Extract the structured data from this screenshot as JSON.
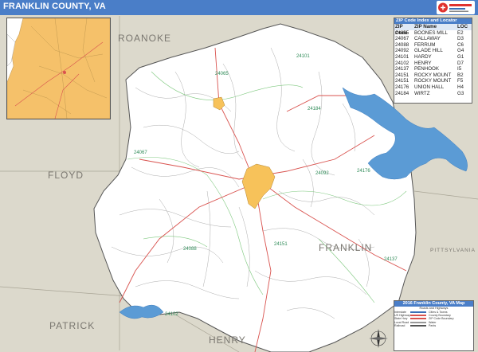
{
  "title": "FRANKLIN COUNTY, VA",
  "colors": {
    "title_bar": "#4a7ec8",
    "surrounding_land": "#dcd9cc",
    "county_fill": "#ffffff",
    "water": "#5b9bd5",
    "city_fill": "#f7c25a",
    "inset_state": "#f5c16a",
    "highways": "#d9534f",
    "minor_roads": "#9a9a9a",
    "route_labels": "#2e8b57"
  },
  "neighbor_counties": {
    "roanoke": "ROANOKE",
    "floyd": "FLOYD",
    "patrick": "PATRICK",
    "henry": "HENRY",
    "pittsylvania": "PITTSYLVANIA"
  },
  "county_label": "FRANKLIN",
  "route_labels": {
    "r24101": "24101",
    "r24065": "24065",
    "r24184": "24184",
    "r24067": "24067",
    "r24092": "24092",
    "r24176": "24176",
    "r24088": "24088",
    "r24151": "24151",
    "r24137": "24137",
    "r24102": "24102"
  },
  "zip_panel": {
    "title": "ZIP Code Index and Locator",
    "headers": {
      "zip": "ZIP Code",
      "name": "ZIP Name",
      "loc": "LOC"
    },
    "rows": [
      {
        "zip": "24065",
        "name": "BOONES MILL",
        "loc": "E2"
      },
      {
        "zip": "24067",
        "name": "CALLAWAY",
        "loc": "D3"
      },
      {
        "zip": "24088",
        "name": "FERRUM",
        "loc": "C6"
      },
      {
        "zip": "24092",
        "name": "GLADE HILL",
        "loc": "G4"
      },
      {
        "zip": "24101",
        "name": "HARDY",
        "loc": "G1"
      },
      {
        "zip": "24102",
        "name": "HENRY",
        "loc": "D7"
      },
      {
        "zip": "24137",
        "name": "PENHOOK",
        "loc": "I5"
      },
      {
        "zip": "24151",
        "name": "ROCKY MOUNT",
        "loc": "B2"
      },
      {
        "zip": "24151",
        "name": "ROCKY MOUNT",
        "loc": "F5"
      },
      {
        "zip": "24176",
        "name": "UNION HALL",
        "loc": "H4"
      },
      {
        "zip": "24184",
        "name": "WIRTZ",
        "loc": "G3"
      }
    ]
  },
  "legend": {
    "title": "2016 Franklin County, VA Map",
    "subtitle": "Roads and Highways",
    "rows": [
      {
        "name": "Interstate",
        "swatch": "#3b6fb6",
        "desc": "Cities & Towns"
      },
      {
        "name": "US Highway",
        "swatch": "#d9534f",
        "desc": "County Boundary"
      },
      {
        "name": "State Hwy",
        "swatch": "#d9534f",
        "desc": "ZIP Code Boundary"
      },
      {
        "name": "Local Road",
        "swatch": "#9a9a9a",
        "desc": "Water"
      },
      {
        "name": "Railroad",
        "swatch": "#555555",
        "desc": "Parks"
      }
    ]
  },
  "icons": {
    "compass": "compass-rose-icon",
    "logo": "map-publisher-logo-icon"
  }
}
